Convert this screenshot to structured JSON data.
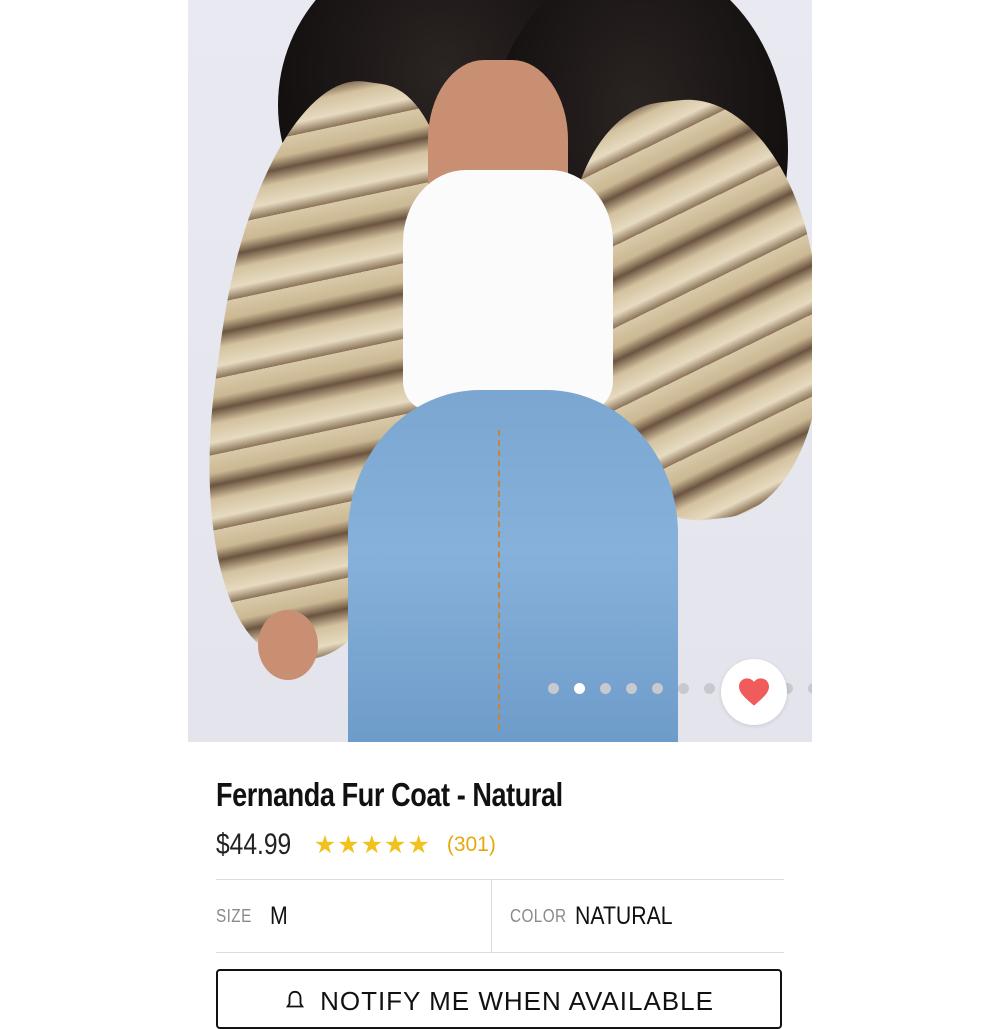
{
  "product": {
    "title": "Fernanda Fur Coat - Natural",
    "price": "$44.99",
    "rating_stars": "★★★★★",
    "rating": 5,
    "review_count": "(301)"
  },
  "gallery": {
    "slide_count": 11,
    "active_slide": 2
  },
  "options": {
    "size_label": "SIZE",
    "size_value": "M",
    "color_label": "COLOR",
    "color_value": "NATURAL"
  },
  "actions": {
    "notify_label": "NOTIFY ME WHEN AVAILABLE",
    "notify_icon": "bell-icon",
    "favorite_icon": "heart-icon"
  },
  "colors": {
    "heart": "#f05b5b",
    "stars": "#f1c21b",
    "reviews": "#e6a80f"
  }
}
